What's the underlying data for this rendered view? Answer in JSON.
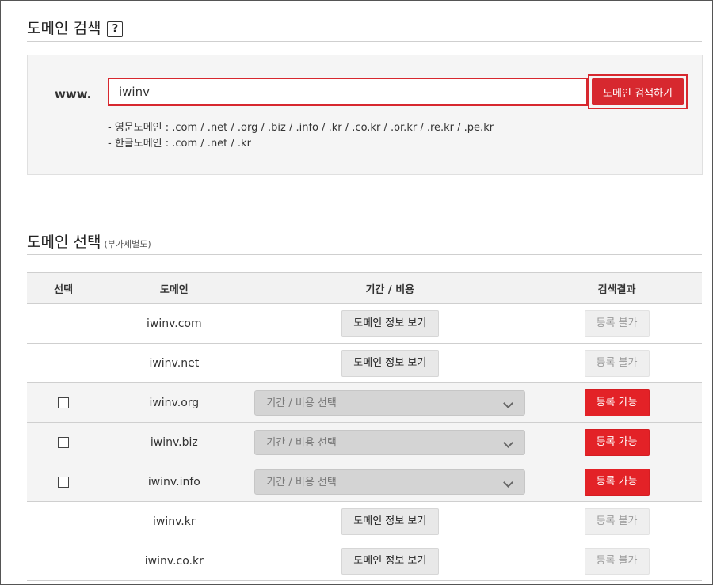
{
  "search_section": {
    "title": "도메인 검색",
    "help": "?"
  },
  "search": {
    "prefix": "www.",
    "value": "iwinv",
    "button": "도메인 검색하기",
    "tld_en": "- 영문도메인 : .com / .net / .org / .biz / .info / .kr / .co.kr / .or.kr / .re.kr / .pe.kr",
    "tld_kr": "- 한글도메인 : .com / .net / .kr"
  },
  "select_section": {
    "title": "도메인 선택",
    "subtitle": "(부가세별도)"
  },
  "table": {
    "headers": [
      "선택",
      "도메인",
      "기간 / 비용",
      "검색결과"
    ],
    "rows": [
      {
        "domain": "iwinv.com",
        "period": "도메인 정보 보기",
        "status": "등록 불가"
      },
      {
        "domain": "iwinv.net",
        "period": "도메인 정보 보기",
        "status": "등록 불가"
      },
      {
        "domain": "iwinv.org",
        "period": "기간 / 비용 선택",
        "status": "등록 가능"
      },
      {
        "domain": "iwinv.biz",
        "period": "기간 / 비용 선택",
        "status": "등록 가능"
      },
      {
        "domain": "iwinv.info",
        "period": "기간 / 비용 선택",
        "status": "등록 가능"
      },
      {
        "domain": "iwinv.kr",
        "period": "도메인 정보 보기",
        "status": "등록 불가"
      },
      {
        "domain": "iwinv.co.kr",
        "period": "도메인 정보 보기",
        "status": "등록 불가"
      }
    ]
  },
  "colors": {
    "accent": "#d7282f",
    "available": "#e32227"
  }
}
